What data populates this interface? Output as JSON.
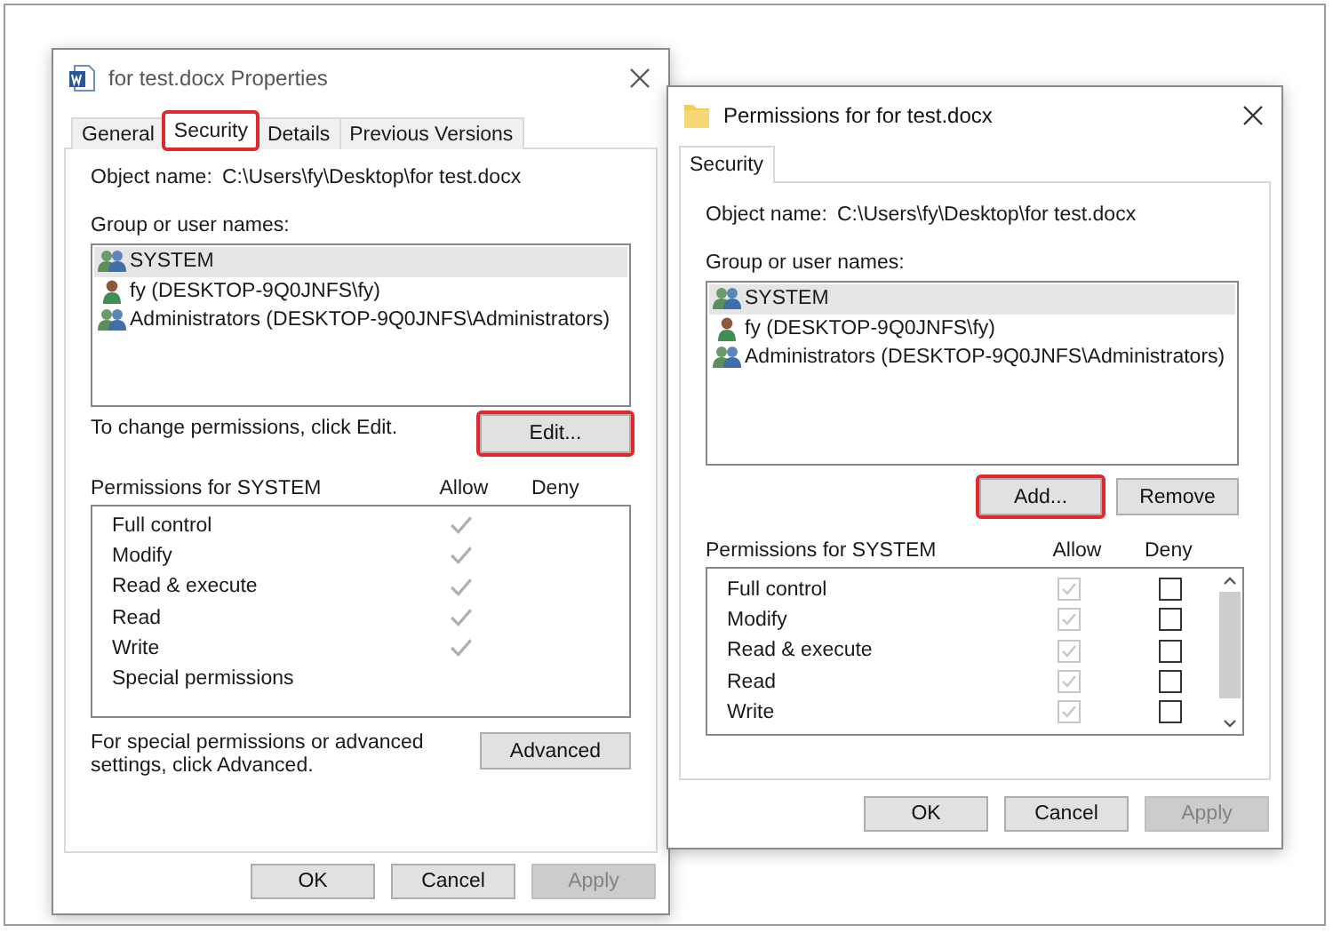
{
  "properties_window": {
    "title": "for test.docx Properties",
    "tabs": [
      {
        "label": "General",
        "selected": false,
        "highlighted": false
      },
      {
        "label": "Security",
        "selected": true,
        "highlighted": true
      },
      {
        "label": "Details",
        "selected": false,
        "highlighted": false
      },
      {
        "label": "Previous Versions",
        "selected": false,
        "highlighted": false
      }
    ],
    "object_name_label": "Object name:",
    "object_name": "C:\\Users\\fy\\Desktop\\for test.docx",
    "group_label": "Group or user names:",
    "users": [
      {
        "name": "SYSTEM",
        "kind": "group",
        "selected": true
      },
      {
        "name": "fy (DESKTOP-9Q0JNFS\\fy)",
        "kind": "user",
        "selected": false
      },
      {
        "name": "Administrators (DESKTOP-9Q0JNFS\\Administrators)",
        "kind": "group",
        "selected": false
      }
    ],
    "change_note": "To change permissions, click Edit.",
    "edit_button": {
      "label": "Edit...",
      "highlighted": true
    },
    "permissions_label": "Permissions for SYSTEM",
    "allow_header": "Allow",
    "deny_header": "Deny",
    "permissions": [
      {
        "name": "Full control",
        "allow": true
      },
      {
        "name": "Modify",
        "allow": true
      },
      {
        "name": "Read & execute",
        "allow": true
      },
      {
        "name": "Read",
        "allow": true
      },
      {
        "name": "Write",
        "allow": true
      },
      {
        "name": "Special permissions",
        "allow": false
      }
    ],
    "advanced_note": "For special permissions or advanced settings, click Advanced.",
    "advanced_button": "Advanced",
    "buttons": [
      {
        "label": "OK",
        "disabled": false
      },
      {
        "label": "Cancel",
        "disabled": false
      },
      {
        "label": "Apply",
        "disabled": true
      }
    ]
  },
  "permissions_window": {
    "title": "Permissions for for test.docx",
    "tabs": [
      {
        "label": "Security",
        "selected": true
      }
    ],
    "object_name_label": "Object name:",
    "object_name": "C:\\Users\\fy\\Desktop\\for test.docx",
    "group_label": "Group or user names:",
    "users": [
      {
        "name": "SYSTEM",
        "kind": "group",
        "selected": true
      },
      {
        "name": "fy (DESKTOP-9Q0JNFS\\fy)",
        "kind": "user",
        "selected": false
      },
      {
        "name": "Administrators (DESKTOP-9Q0JNFS\\Administrators)",
        "kind": "group",
        "selected": false
      }
    ],
    "list_buttons": [
      {
        "label": "Add...",
        "highlighted": true
      },
      {
        "label": "Remove",
        "highlighted": false
      }
    ],
    "permissions_label": "Permissions for SYSTEM",
    "allow_header": "Allow",
    "deny_header": "Deny",
    "permissions": [
      {
        "name": "Full control",
        "allow": true,
        "allow_disabled": true,
        "deny": false
      },
      {
        "name": "Modify",
        "allow": true,
        "allow_disabled": true,
        "deny": false
      },
      {
        "name": "Read & execute",
        "allow": true,
        "allow_disabled": true,
        "deny": false
      },
      {
        "name": "Read",
        "allow": true,
        "allow_disabled": true,
        "deny": false
      },
      {
        "name": "Write",
        "allow": true,
        "allow_disabled": true,
        "deny": false
      }
    ],
    "buttons": [
      {
        "label": "OK",
        "disabled": false
      },
      {
        "label": "Cancel",
        "disabled": false
      },
      {
        "label": "Apply",
        "disabled": true
      }
    ]
  }
}
